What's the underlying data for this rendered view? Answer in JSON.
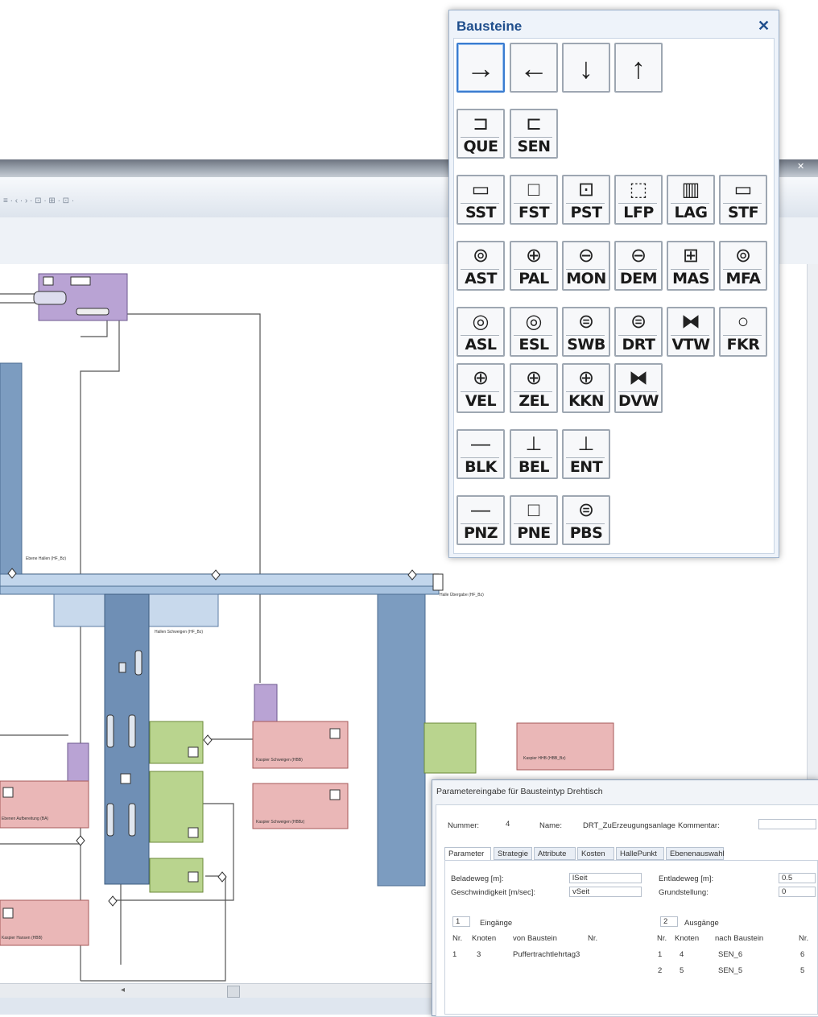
{
  "palette": {
    "title": "Bausteine",
    "close": "✕",
    "arrows": [
      {
        "glyph": "→",
        "name": "arrow-right"
      },
      {
        "glyph": "←",
        "name": "arrow-left"
      },
      {
        "glyph": "↓",
        "name": "arrow-down"
      },
      {
        "glyph": "↑",
        "name": "arrow-up"
      }
    ],
    "row1": [
      {
        "label": "QUE",
        "glyph": "⊐"
      },
      {
        "label": "SEN",
        "glyph": "⊏"
      }
    ],
    "row2": [
      {
        "label": "SST",
        "glyph": "▭"
      },
      {
        "label": "FST",
        "glyph": "□"
      },
      {
        "label": "PST",
        "glyph": "⊡"
      },
      {
        "label": "LFP",
        "glyph": "⬚"
      },
      {
        "label": "LAG",
        "glyph": "▥"
      },
      {
        "label": "STF",
        "glyph": "▭"
      }
    ],
    "row3": [
      {
        "label": "AST",
        "glyph": "⊚"
      },
      {
        "label": "PAL",
        "glyph": "⊕"
      },
      {
        "label": "MON",
        "glyph": "⊖"
      },
      {
        "label": "DEM",
        "glyph": "⊖"
      },
      {
        "label": "MAS",
        "glyph": "⊞"
      },
      {
        "label": "MFA",
        "glyph": "⊚"
      }
    ],
    "row4": [
      {
        "label": "ASL",
        "glyph": "◎"
      },
      {
        "label": "ESL",
        "glyph": "◎"
      },
      {
        "label": "SWB",
        "glyph": "⊜"
      },
      {
        "label": "DRT",
        "glyph": "⊜"
      },
      {
        "label": "VTW",
        "glyph": "⧓"
      },
      {
        "label": "FKR",
        "glyph": "○"
      }
    ],
    "row5": [
      {
        "label": "VEL",
        "glyph": "⊕"
      },
      {
        "label": "ZEL",
        "glyph": "⊕"
      },
      {
        "label": "KKN",
        "glyph": "⊕"
      },
      {
        "label": "DVW",
        "glyph": "⧓"
      }
    ],
    "row6": [
      {
        "label": "BLK",
        "glyph": "—"
      },
      {
        "label": "BEL",
        "glyph": "⊥"
      },
      {
        "label": "ENT",
        "glyph": "⊥"
      }
    ],
    "row7": [
      {
        "label": "PNZ",
        "glyph": "—"
      },
      {
        "label": "PNE",
        "glyph": "□"
      },
      {
        "label": "PBS",
        "glyph": "⊜"
      }
    ]
  },
  "diagram": {
    "labels": [
      "Ebene Hallen (HF_Bz)",
      "Hallen Schweigen (HF_Bz)",
      "Halle Übergabe (HF_Bz)",
      "Kaspier Schweigen (HBB)",
      "Kaspier Schweigen (HBBz)",
      "Kaspier HHB (HBB_Bz)",
      "Ebenen Aufbereitung (BA)",
      "Kaspier Hansen (HBB)"
    ]
  },
  "param_dialog": {
    "title": "Parametereingabe für Bausteintyp Drehtisch",
    "nummer_label": "Nummer:",
    "nummer_value": "4",
    "name_label": "Name:",
    "name_value": "DRT_ZuErzeugungsanlage",
    "kommentar_label": "Kommentar:",
    "tabs": [
      "Parameter",
      "Strategie",
      "Attribute",
      "Kosten",
      "HallePunkt",
      "Ebenenauswahl"
    ],
    "fields": {
      "beladeweg_label": "Beladeweg [m]:",
      "beladeweg_value": "lSeit",
      "geschwindigkeit_label": "Geschwindigkeit [m/sec]:",
      "geschwindigkeit_value": "vSeit",
      "entladeweg_label": "Entladeweg [m]:",
      "entladeweg_value": "0.5",
      "grundstellung_label": "Grundstellung:",
      "grundstellung_value": "0"
    },
    "eingaenge": {
      "count": "1",
      "label": "Eingänge",
      "headers": [
        "Nr.",
        "Knoten",
        "von Baustein",
        "Nr."
      ],
      "rows": [
        [
          "1",
          "3",
          "Puffertrachtlehrtag3",
          ""
        ]
      ]
    },
    "ausgaenge": {
      "count": "2",
      "label": "Ausgänge",
      "headers": [
        "Nr.",
        "Knoten",
        "nach Baustein",
        "Nr."
      ],
      "rows": [
        [
          "1",
          "4",
          "SEN_6",
          "6"
        ],
        [
          "2",
          "5",
          "SEN_5",
          "5"
        ]
      ]
    }
  }
}
